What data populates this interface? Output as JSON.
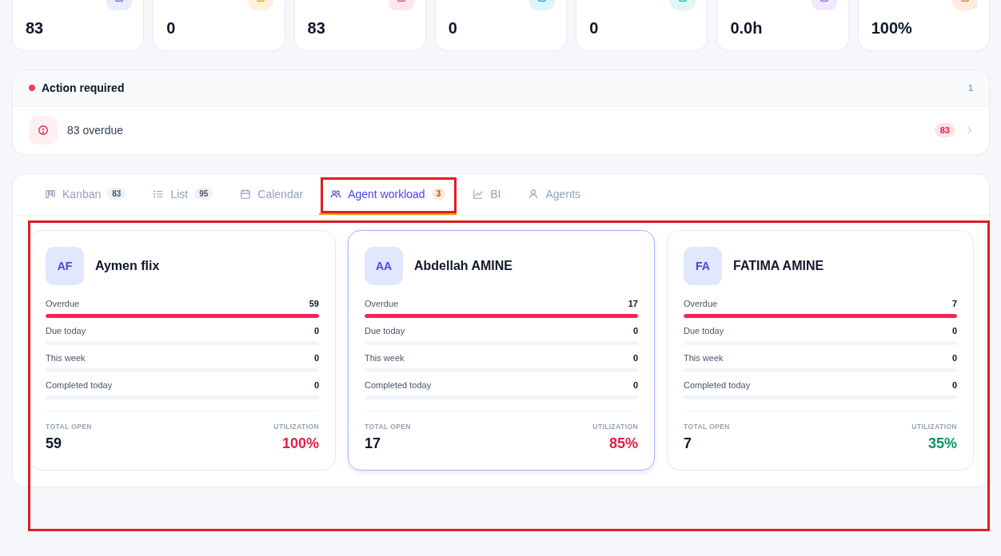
{
  "stats": [
    {
      "value": "83",
      "color": "#6366f1"
    },
    {
      "value": "0",
      "color": "#f59e0b"
    },
    {
      "value": "83",
      "color": "#f43f5e"
    },
    {
      "value": "0",
      "color": "#0ea5e9"
    },
    {
      "value": "0",
      "color": "#14b8a6"
    },
    {
      "value": "0.0h",
      "color": "#8b5cf6"
    },
    {
      "value": "100%",
      "color": "#f97316"
    }
  ],
  "action_panel": {
    "title": "Action required",
    "count": "1",
    "items": [
      {
        "text": "83 overdue",
        "badge": "83"
      }
    ]
  },
  "tabs": [
    {
      "label": "Kanban",
      "kind": "kanban",
      "badge": "83",
      "selected": false,
      "highlighted": false
    },
    {
      "label": "List",
      "kind": "list",
      "badge": "95",
      "selected": false,
      "highlighted": false
    },
    {
      "label": "Calendar",
      "kind": "calendar",
      "selected": false,
      "highlighted": false
    },
    {
      "label": "Agent workload",
      "kind": "people",
      "badge": "3",
      "selected": true,
      "highlighted": true
    },
    {
      "label": "BI",
      "kind": "chart",
      "selected": false,
      "highlighted": false
    },
    {
      "label": "Agents",
      "kind": "person",
      "selected": false,
      "highlighted": false
    }
  ],
  "workload_highlighted": true,
  "agents": [
    {
      "initials": "AF",
      "name": "Aymen flix",
      "selected": false,
      "metrics": [
        {
          "label": "Overdue",
          "value": "59",
          "level": 1
        },
        {
          "label": "Due today",
          "value": "0",
          "level": 0
        },
        {
          "label": "This week",
          "value": "0",
          "level": 0
        },
        {
          "label": "Completed today",
          "value": "0",
          "level": 0
        }
      ],
      "total_label": "TOTAL OPEN",
      "total": "59",
      "utilization_label": "UTILIZATION",
      "utilization": "100%",
      "color": "#e11d48"
    },
    {
      "initials": "AA",
      "name": "Abdellah AMINE",
      "selected": true,
      "metrics": [
        {
          "label": "Overdue",
          "value": "17",
          "level": 1
        },
        {
          "label": "Due today",
          "value": "0",
          "level": 0
        },
        {
          "label": "This week",
          "value": "0",
          "level": 0
        },
        {
          "label": "Completed today",
          "value": "0",
          "level": 0
        }
      ],
      "total_label": "TOTAL OPEN",
      "total": "17",
      "utilization_label": "UTILIZATION",
      "utilization": "85%",
      "color": "#e11d48"
    },
    {
      "initials": "FA",
      "name": "FATIMA AMINE",
      "selected": false,
      "metrics": [
        {
          "label": "Overdue",
          "value": "7",
          "level": 1
        },
        {
          "label": "Due today",
          "value": "0",
          "level": 0
        },
        {
          "label": "This week",
          "value": "0",
          "level": 0
        },
        {
          "label": "Completed today",
          "value": "0",
          "level": 0
        }
      ],
      "total_label": "TOTAL OPEN",
      "total": "7",
      "utilization_label": "UTILIZATION",
      "utilization": "35%",
      "color": "#059669"
    }
  ]
}
